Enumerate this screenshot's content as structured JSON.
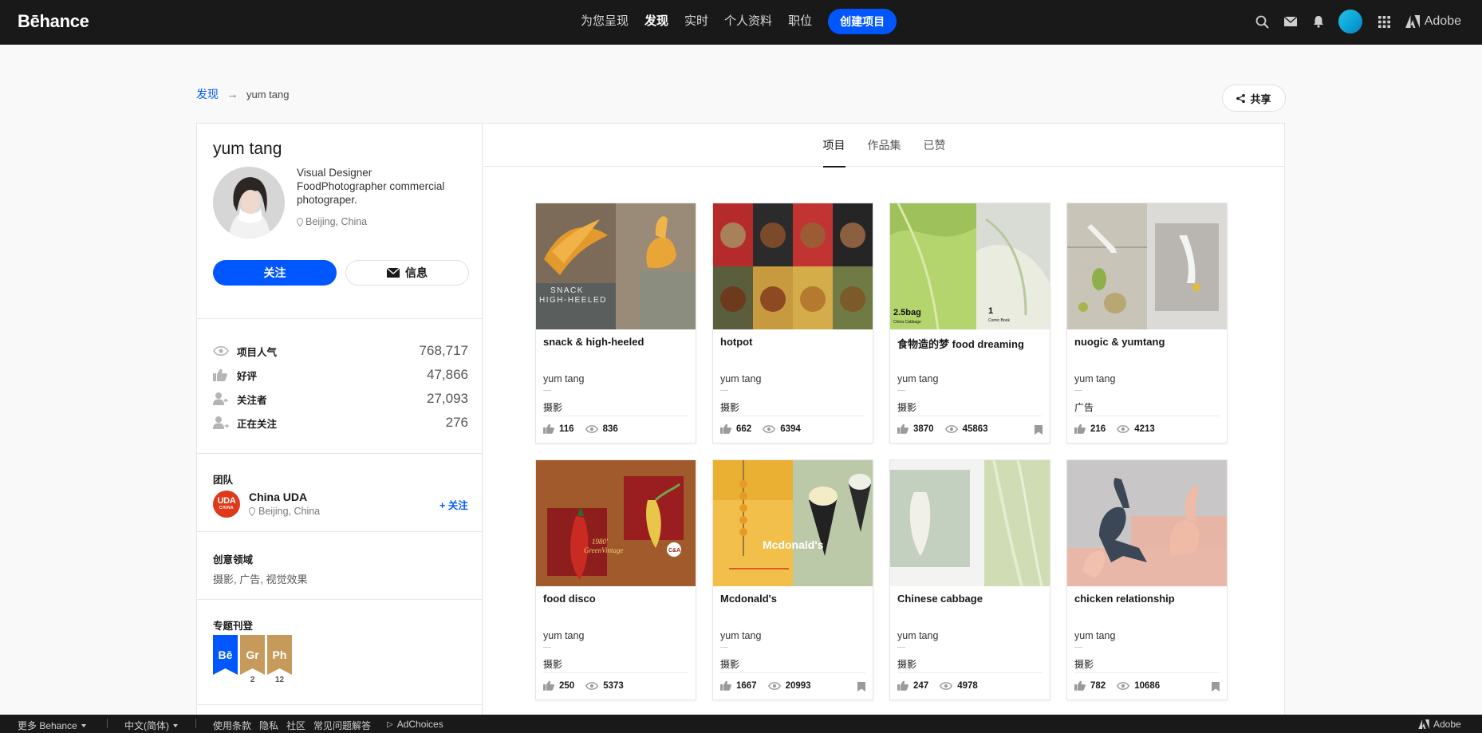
{
  "nav": {
    "logo": "Bēhance",
    "items": [
      "为您呈现",
      "发现",
      "实时",
      "个人资料",
      "职位"
    ],
    "create_label": "创建项目",
    "adobe_label": "Adobe"
  },
  "breadcrumb": {
    "root": "发现",
    "arrow": "→",
    "current": "yum tang"
  },
  "share_label": "共享",
  "profile": {
    "name": "yum tang",
    "bio": "Visual Designer FoodPhotographer commercial photograper.",
    "location": "Beijing, China",
    "follow_label": "关注",
    "message_label": "信息"
  },
  "stats": [
    {
      "label": "项目人气",
      "value": "768,717",
      "icon": "eye-icon"
    },
    {
      "label": "好评",
      "value": "47,866",
      "icon": "thumbs-up-icon"
    },
    {
      "label": "关注者",
      "value": "27,093",
      "icon": "followers-icon"
    },
    {
      "label": "正在关注",
      "value": "276",
      "icon": "following-icon"
    }
  ],
  "team": {
    "heading": "团队",
    "logo_text": "UDA",
    "logo_sub": "CHINA",
    "name": "China UDA",
    "location": "Beijing, China",
    "follow_label": "+ 关注"
  },
  "fields": {
    "heading": "创意领域",
    "value": "摄影, 广告, 视觉效果"
  },
  "features": {
    "heading": "专题刊登",
    "badges": [
      {
        "label": "Bē",
        "count": "",
        "color": "#0057ff"
      },
      {
        "label": "Gr",
        "count": "2",
        "color": "#c69a5a"
      },
      {
        "label": "Ph",
        "count": "12",
        "color": "#c69a5a"
      }
    ]
  },
  "tabs": [
    "项目",
    "作品集",
    "已赞"
  ],
  "projects": [
    {
      "title": "snack & high-heeled",
      "owner": "yum tang",
      "field": "摄影",
      "likes": "116",
      "views": "836",
      "bookmark": false
    },
    {
      "title": "hotpot",
      "owner": "yum tang",
      "field": "摄影",
      "likes": "662",
      "views": "6394",
      "bookmark": false
    },
    {
      "title": "食物造的梦 food dreaming",
      "owner": "yum tang",
      "field": "摄影",
      "likes": "3870",
      "views": "45863",
      "bookmark": true
    },
    {
      "title": "nuogic & yumtang",
      "owner": "yum tang",
      "field": "广告",
      "likes": "216",
      "views": "4213",
      "bookmark": false
    },
    {
      "title": "food disco",
      "owner": "yum tang",
      "field": "摄影",
      "likes": "250",
      "views": "5373",
      "bookmark": false
    },
    {
      "title": "Mcdonald's",
      "owner": "yum tang",
      "field": "摄影",
      "likes": "1667",
      "views": "20993",
      "bookmark": true
    },
    {
      "title": "Chinese cabbage",
      "owner": "yum tang",
      "field": "摄影",
      "likes": "247",
      "views": "4978",
      "bookmark": false
    },
    {
      "title": "chicken relationship",
      "owner": "yum tang",
      "field": "摄影",
      "likes": "782",
      "views": "10686",
      "bookmark": true
    }
  ],
  "thumb_text": {
    "snack": "SNACK\nHIGH-HEELED",
    "cabbage_left": "2.5bag",
    "cabbage_left_sub": "China Cabbage",
    "cabbage_right": "1",
    "cabbage_right_sub": "Comic Book",
    "disco": "1980'\nGreenVintage",
    "disco_logo": "C&A",
    "mcd": "Mcdonald's"
  },
  "footer": {
    "more": "更多 Behance",
    "language": "中文(简体)",
    "links": [
      "使用条款",
      "隐私",
      "社区",
      "常见问题解答"
    ],
    "adchoices": "AdChoices",
    "adobe": "Adobe"
  },
  "colors": {
    "accent": "#0057ff",
    "topbar": "#191919"
  }
}
